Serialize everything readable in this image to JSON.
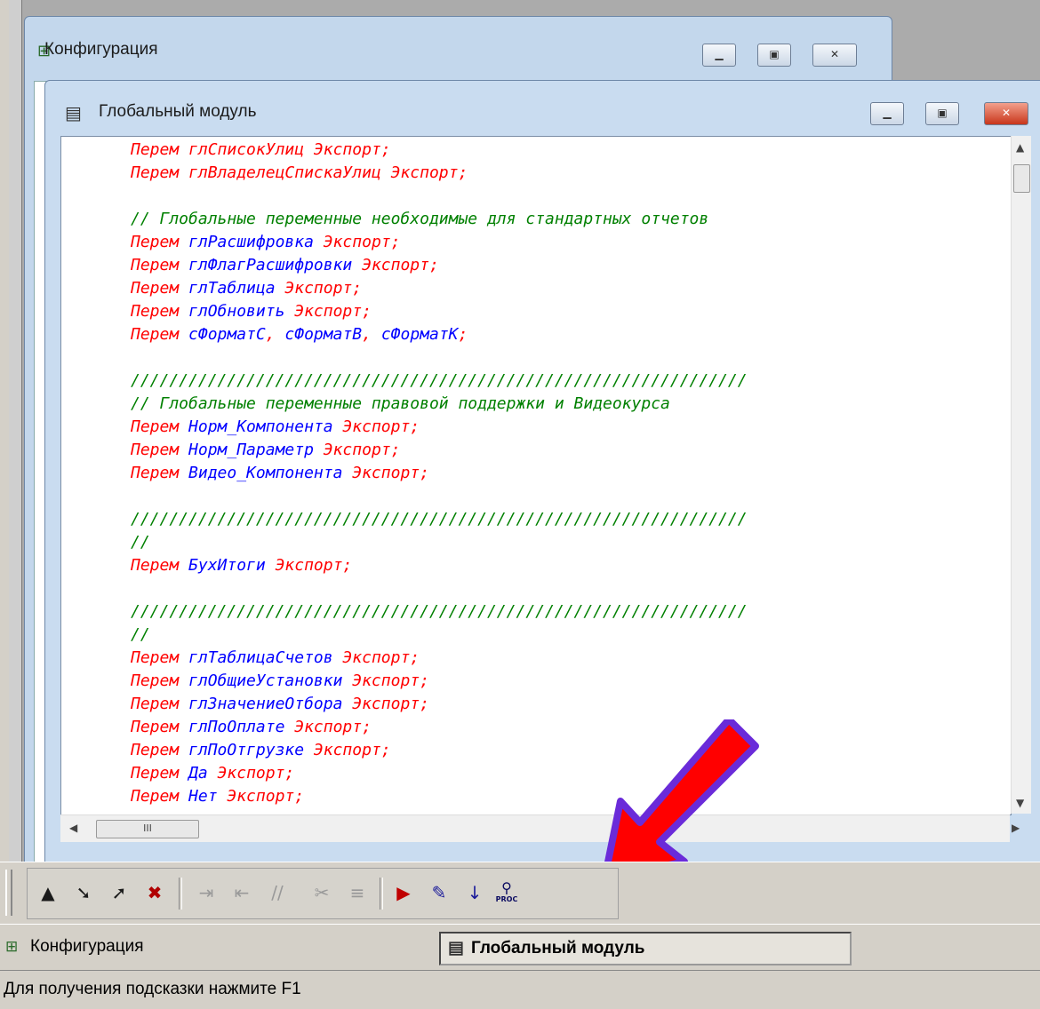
{
  "config_window": {
    "title": "Конфигурация"
  },
  "module_window": {
    "title": "Глобальный модуль"
  },
  "code_lines": [
    [
      {
        "t": "Перем ",
        "c": "red"
      },
      {
        "t": "глСписокУлиц",
        "c": "red"
      },
      {
        "t": " Экспорт;",
        "c": "red"
      }
    ],
    [
      {
        "t": "Перем ",
        "c": "red"
      },
      {
        "t": "глВладелецСпискаУлиц",
        "c": "red"
      },
      {
        "t": " Экспорт;",
        "c": "red"
      }
    ],
    [],
    [
      {
        "t": "// Глобальные переменные необходимые для стандартных отчетов",
        "c": "green"
      }
    ],
    [
      {
        "t": "Перем ",
        "c": "red"
      },
      {
        "t": "глРасшифровка",
        "c": "blue"
      },
      {
        "t": " Экспорт;",
        "c": "red"
      }
    ],
    [
      {
        "t": "Перем ",
        "c": "red"
      },
      {
        "t": "глФлагРасшифровки",
        "c": "blue"
      },
      {
        "t": " Экспорт;",
        "c": "red"
      }
    ],
    [
      {
        "t": "Перем ",
        "c": "red"
      },
      {
        "t": "глТаблица",
        "c": "blue"
      },
      {
        "t": " Экспорт;",
        "c": "red"
      }
    ],
    [
      {
        "t": "Перем ",
        "c": "red"
      },
      {
        "t": "глОбновить",
        "c": "blue"
      },
      {
        "t": " Экспорт;",
        "c": "red"
      }
    ],
    [
      {
        "t": "Перем ",
        "c": "red"
      },
      {
        "t": "сФорматС",
        "c": "blue"
      },
      {
        "t": ", ",
        "c": "red"
      },
      {
        "t": "сФорматВ",
        "c": "blue"
      },
      {
        "t": ", ",
        "c": "red"
      },
      {
        "t": "сФорматК",
        "c": "blue"
      },
      {
        "t": ";",
        "c": "red"
      }
    ],
    [],
    [
      {
        "t": "////////////////////////////////////////////////////////////////",
        "c": "green"
      }
    ],
    [
      {
        "t": "// Глобальные переменные правовой поддержки и Видеокурса",
        "c": "green"
      }
    ],
    [
      {
        "t": "Перем ",
        "c": "red"
      },
      {
        "t": "Норм_Компонента",
        "c": "blue"
      },
      {
        "t": " Экспорт;",
        "c": "red"
      }
    ],
    [
      {
        "t": "Перем ",
        "c": "red"
      },
      {
        "t": "Норм_Параметр",
        "c": "blue"
      },
      {
        "t": " Экспорт;",
        "c": "red"
      }
    ],
    [
      {
        "t": "Перем ",
        "c": "red"
      },
      {
        "t": "Видео_Компонента",
        "c": "blue"
      },
      {
        "t": " Экспорт;",
        "c": "red"
      }
    ],
    [],
    [
      {
        "t": "////////////////////////////////////////////////////////////////",
        "c": "green"
      }
    ],
    [
      {
        "t": "//",
        "c": "green"
      }
    ],
    [
      {
        "t": "Перем ",
        "c": "red"
      },
      {
        "t": "БухИтоги",
        "c": "blue"
      },
      {
        "t": " Экспорт;",
        "c": "red"
      }
    ],
    [],
    [
      {
        "t": "////////////////////////////////////////////////////////////////",
        "c": "green"
      }
    ],
    [
      {
        "t": "//",
        "c": "green"
      }
    ],
    [
      {
        "t": "Перем ",
        "c": "red"
      },
      {
        "t": "глТаблицаСчетов",
        "c": "blue"
      },
      {
        "t": " Экспорт;",
        "c": "red"
      }
    ],
    [
      {
        "t": "Перем ",
        "c": "red"
      },
      {
        "t": "глОбщиеУстановки",
        "c": "blue"
      },
      {
        "t": " Экспорт;",
        "c": "red"
      }
    ],
    [
      {
        "t": "Перем ",
        "c": "red"
      },
      {
        "t": "глЗначениеОтбора",
        "c": "blue"
      },
      {
        "t": " Экспорт;",
        "c": "red"
      }
    ],
    [
      {
        "t": "Перем ",
        "c": "red"
      },
      {
        "t": "глПоОплате",
        "c": "blue"
      },
      {
        "t": " Экспорт;",
        "c": "red"
      }
    ],
    [
      {
        "t": "Перем ",
        "c": "red"
      },
      {
        "t": "глПоОтгрузке",
        "c": "blue"
      },
      {
        "t": " Экспорт;",
        "c": "red"
      }
    ],
    [
      {
        "t": "Перем ",
        "c": "red"
      },
      {
        "t": "Да",
        "c": "blue"
      },
      {
        "t": " Экспорт;",
        "c": "red"
      }
    ],
    [
      {
        "t": "Перем ",
        "c": "red"
      },
      {
        "t": "Нет",
        "c": "blue"
      },
      {
        "t": " Экспорт;",
        "c": "red"
      }
    ]
  ],
  "scroll": {
    "hthumb_label": "III"
  },
  "toolbar": {
    "icons": [
      {
        "name": "toggle-bookmark-icon",
        "glyph": "▲",
        "color": "#1a1a1a"
      },
      {
        "name": "next-bookmark-icon",
        "glyph": "➘",
        "color": "#1a1a1a"
      },
      {
        "name": "prev-bookmark-icon",
        "glyph": "➚",
        "color": "#1a1a1a"
      },
      {
        "name": "clear-bookmarks-icon",
        "glyph": "✖",
        "color": "#b00000"
      },
      {
        "name": "indent-icon",
        "glyph": "⇥",
        "color": "#999999"
      },
      {
        "name": "outdent-icon",
        "glyph": "⇤",
        "color": "#999999"
      },
      {
        "name": "comment-icon",
        "glyph": "//",
        "color": "#999999"
      },
      {
        "name": "uncomment-icon",
        "glyph": "✂",
        "color": "#999999"
      },
      {
        "name": "format-block-icon",
        "glyph": "≡",
        "color": "#999999"
      },
      {
        "name": "syntax-check-icon",
        "glyph": "▶",
        "color": "#c00000"
      },
      {
        "name": "template-icon",
        "glyph": "✎",
        "color": "#1a1a9a"
      },
      {
        "name": "insert-template-icon",
        "glyph": "↓",
        "color": "#1a1a9a"
      },
      {
        "name": "procedures-list-icon",
        "glyph": "⚲",
        "color": "#0a0a60",
        "label": "PROC"
      }
    ]
  },
  "tabs": [
    {
      "label": "Конфигурация",
      "active": false
    },
    {
      "label": "Глобальный модуль",
      "active": true
    }
  ],
  "status": {
    "text": "Для получения подсказки нажмите F1"
  },
  "colors": {
    "keyword": "#ff0000",
    "identifier": "#0000ff",
    "comment": "#008000",
    "arrow": "#ff0000",
    "arrow_border": "#6a2bd9"
  }
}
